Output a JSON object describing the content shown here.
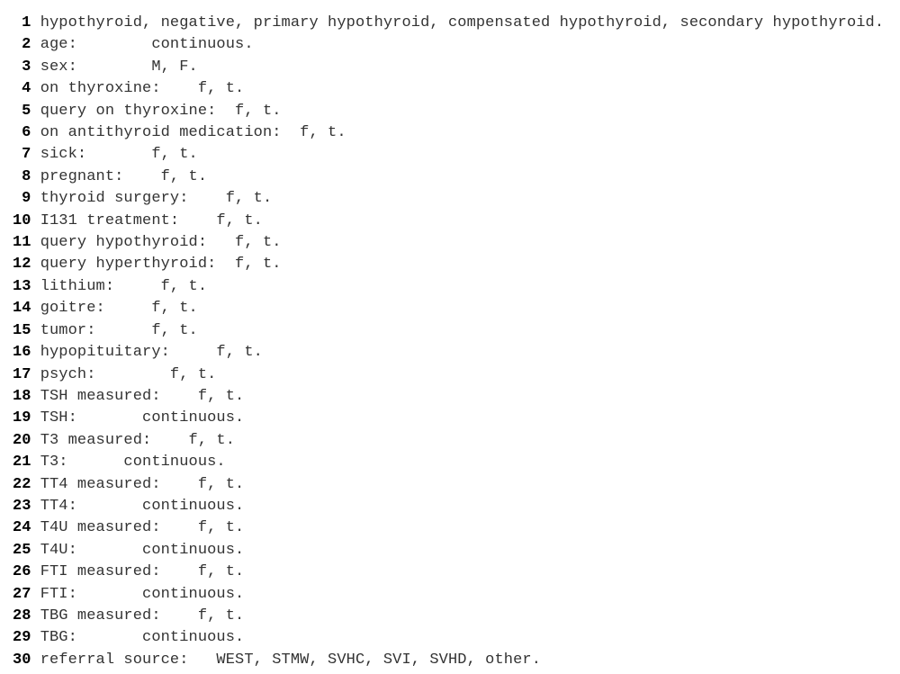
{
  "lines": [
    {
      "n": "1",
      "text": "hypothyroid, negative, primary hypothyroid, compensated hypothyroid, secondary hypothyroid."
    },
    {
      "n": "2",
      "text": "age:        continuous."
    },
    {
      "n": "3",
      "text": "sex:        M, F."
    },
    {
      "n": "4",
      "text": "on thyroxine:    f, t."
    },
    {
      "n": "5",
      "text": "query on thyroxine:  f, t."
    },
    {
      "n": "6",
      "text": "on antithyroid medication:  f, t."
    },
    {
      "n": "7",
      "text": "sick:       f, t."
    },
    {
      "n": "8",
      "text": "pregnant:    f, t."
    },
    {
      "n": "9",
      "text": "thyroid surgery:    f, t."
    },
    {
      "n": "10",
      "text": "I131 treatment:    f, t."
    },
    {
      "n": "11",
      "text": "query hypothyroid:   f, t."
    },
    {
      "n": "12",
      "text": "query hyperthyroid:  f, t."
    },
    {
      "n": "13",
      "text": "lithium:     f, t."
    },
    {
      "n": "14",
      "text": "goitre:     f, t."
    },
    {
      "n": "15",
      "text": "tumor:      f, t."
    },
    {
      "n": "16",
      "text": "hypopituitary:     f, t."
    },
    {
      "n": "17",
      "text": "psych:        f, t."
    },
    {
      "n": "18",
      "text": "TSH measured:    f, t."
    },
    {
      "n": "19",
      "text": "TSH:       continuous."
    },
    {
      "n": "20",
      "text": "T3 measured:    f, t."
    },
    {
      "n": "21",
      "text": "T3:      continuous."
    },
    {
      "n": "22",
      "text": "TT4 measured:    f, t."
    },
    {
      "n": "23",
      "text": "TT4:       continuous."
    },
    {
      "n": "24",
      "text": "T4U measured:    f, t."
    },
    {
      "n": "25",
      "text": "T4U:       continuous."
    },
    {
      "n": "26",
      "text": "FTI measured:    f, t."
    },
    {
      "n": "27",
      "text": "FTI:       continuous."
    },
    {
      "n": "28",
      "text": "TBG measured:    f, t."
    },
    {
      "n": "29",
      "text": "TBG:       continuous."
    },
    {
      "n": "30",
      "text": "referral source:   WEST, STMW, SVHC, SVI, SVHD, other."
    }
  ]
}
